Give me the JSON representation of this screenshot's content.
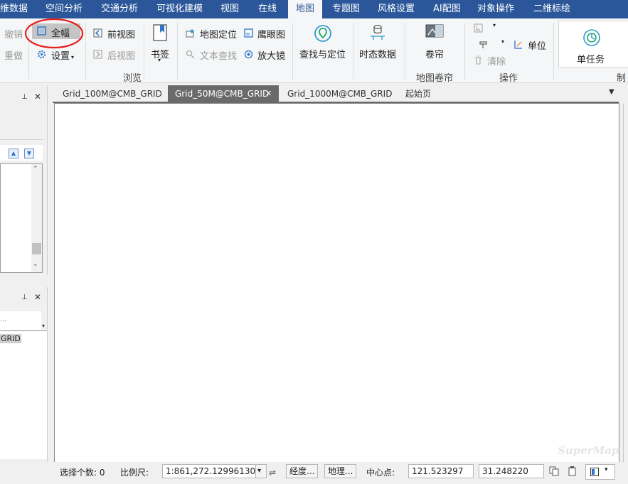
{
  "menu": {
    "tabs": [
      "维数据",
      "空间分析",
      "交通分析",
      "可视化建模",
      "视图",
      "在线",
      "地图",
      "专题图",
      "风格设置",
      "AI配图",
      "对象操作",
      "二维标绘"
    ],
    "active_index": 6
  },
  "ribbon": {
    "undo": "撤销",
    "redo": "重做",
    "full_extent": "全幅",
    "settings": "设置",
    "prev_view": "前视图",
    "next_view": "后视图",
    "bookmark": "书签",
    "map_locate": "地图定位",
    "text_search": "文本查找",
    "overview": "鹰眼图",
    "magnifier": "放大镜",
    "find_locate": "查找与定位",
    "temporal_data": "时态数据",
    "swipe": "卷帘",
    "clear": "清除",
    "unit": "单位",
    "single_task": "单任务",
    "groups": {
      "browse": "浏览",
      "swipe": "地图卷帘",
      "operate": "操作",
      "make": "制"
    }
  },
  "doc_tabs": [
    {
      "label": "Grid_100M@CMB_GRID"
    },
    {
      "label": "Grid_50M@CMB_GRID",
      "close": "✕"
    },
    {
      "label": "Grid_1000M@CMB_GRID"
    },
    {
      "label": "起始页"
    }
  ],
  "left_panes": {
    "pane2_text_partial": "...",
    "pane2_item": "GRID"
  },
  "watermark": "SuperMap",
  "status": {
    "selection_count_label": "选择个数: 0",
    "scale_label": "比例尺:",
    "scale_value": "1:861,272.129961309",
    "longitude_btn": "经度...",
    "geo_btn": "地理...",
    "center_label": "中心点:",
    "center_x": "121.523297",
    "center_y": "31.248220"
  },
  "colors": {
    "menu_bg": "#2b579a",
    "annotation_circle": "#e8201a"
  }
}
